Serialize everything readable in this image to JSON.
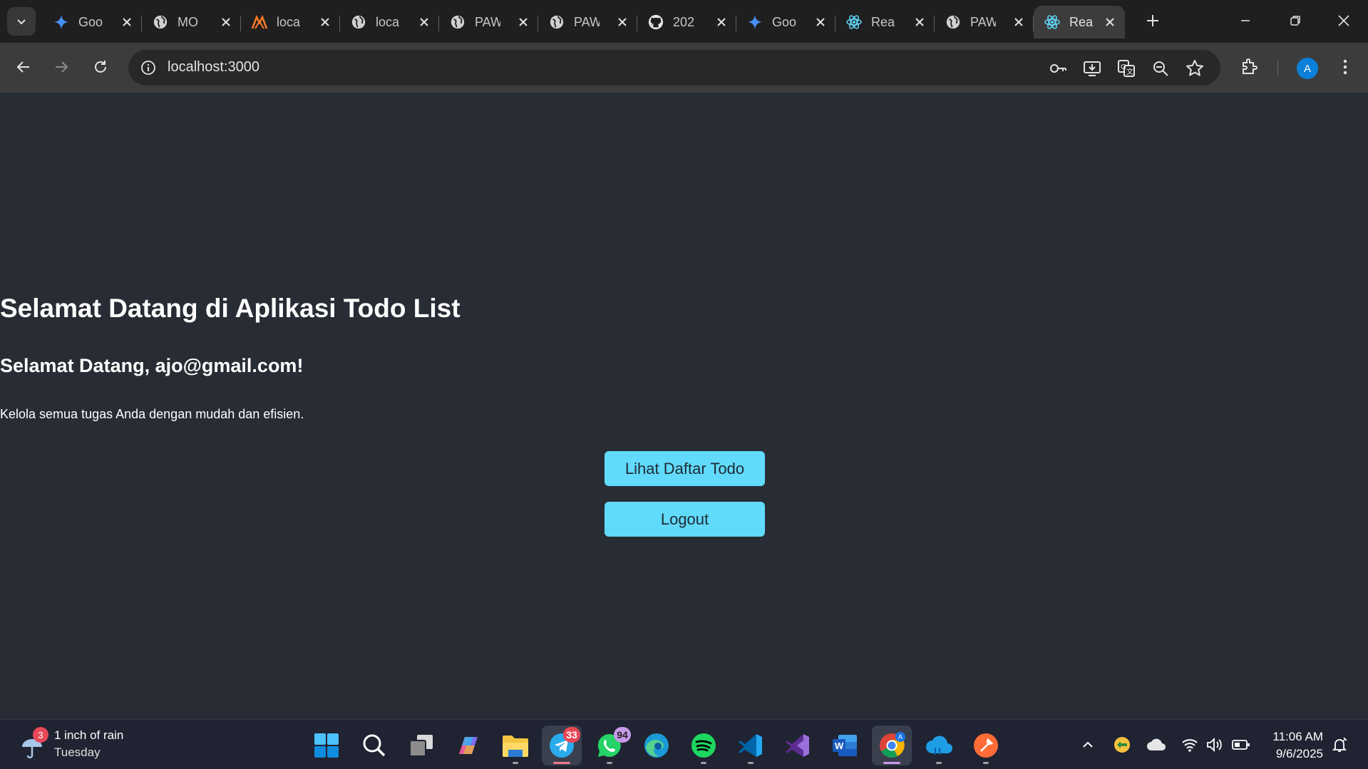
{
  "browser": {
    "tabs": [
      {
        "title": "Goo",
        "icon": "gemini-icon"
      },
      {
        "title": "MO",
        "icon": "globe-icon"
      },
      {
        "title": "loca",
        "icon": "xampp-icon"
      },
      {
        "title": "loca",
        "icon": "globe-icon"
      },
      {
        "title": "PAW",
        "icon": "globe-icon"
      },
      {
        "title": "PAW",
        "icon": "globe-icon"
      },
      {
        "title": "202",
        "icon": "github-icon"
      },
      {
        "title": "Goo",
        "icon": "gemini-icon"
      },
      {
        "title": "Rea",
        "icon": "react-icon"
      },
      {
        "title": "PAW",
        "icon": "globe-icon"
      },
      {
        "title": "Rea",
        "icon": "react-icon",
        "active": true
      }
    ],
    "url": "localhost:3000",
    "profile_initial": "A"
  },
  "page": {
    "title": "Selamat Datang di Aplikasi Todo List",
    "welcome": "Selamat Datang, ajo@gmail.com!",
    "description": "Kelola semua tugas Anda dengan mudah dan efisien.",
    "view_todo_button": "Lihat Daftar Todo",
    "logout_button": "Logout"
  },
  "taskbar": {
    "weather": {
      "line1": "1 inch of rain",
      "line2": "Tuesday",
      "badge": "3"
    },
    "telegram_badge": "33",
    "whatsapp_badge": "94",
    "clock": {
      "time": "11:06 AM",
      "date": "9/6/2025"
    }
  },
  "colors": {
    "page_background": "#282c34",
    "button": "#61dafb",
    "browser_toolbar": "#3c3c3c"
  }
}
